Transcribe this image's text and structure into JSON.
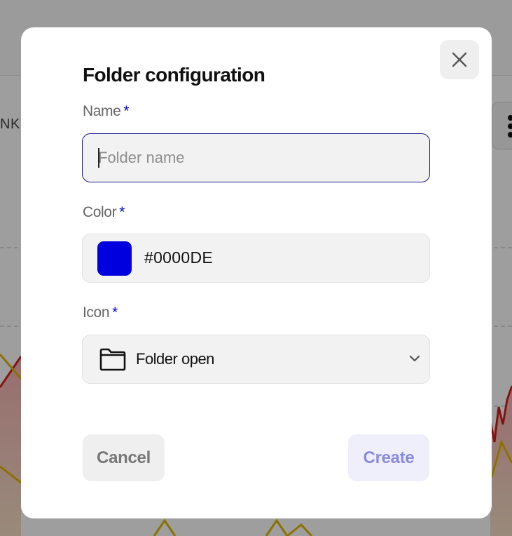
{
  "background": {
    "column_text": "NKS"
  },
  "modal": {
    "title": "Folder configuration",
    "required_marker": "*",
    "name": {
      "label": "Name",
      "value": "",
      "placeholder": "Folder name"
    },
    "color": {
      "label": "Color",
      "value": "#0000DE",
      "swatch_color": "#0000DE"
    },
    "icon": {
      "label": "Icon",
      "selected_label": "Folder open",
      "selected_icon": "folder-open-icon"
    },
    "buttons": {
      "cancel_label": "Cancel",
      "create_label": "Create"
    }
  }
}
